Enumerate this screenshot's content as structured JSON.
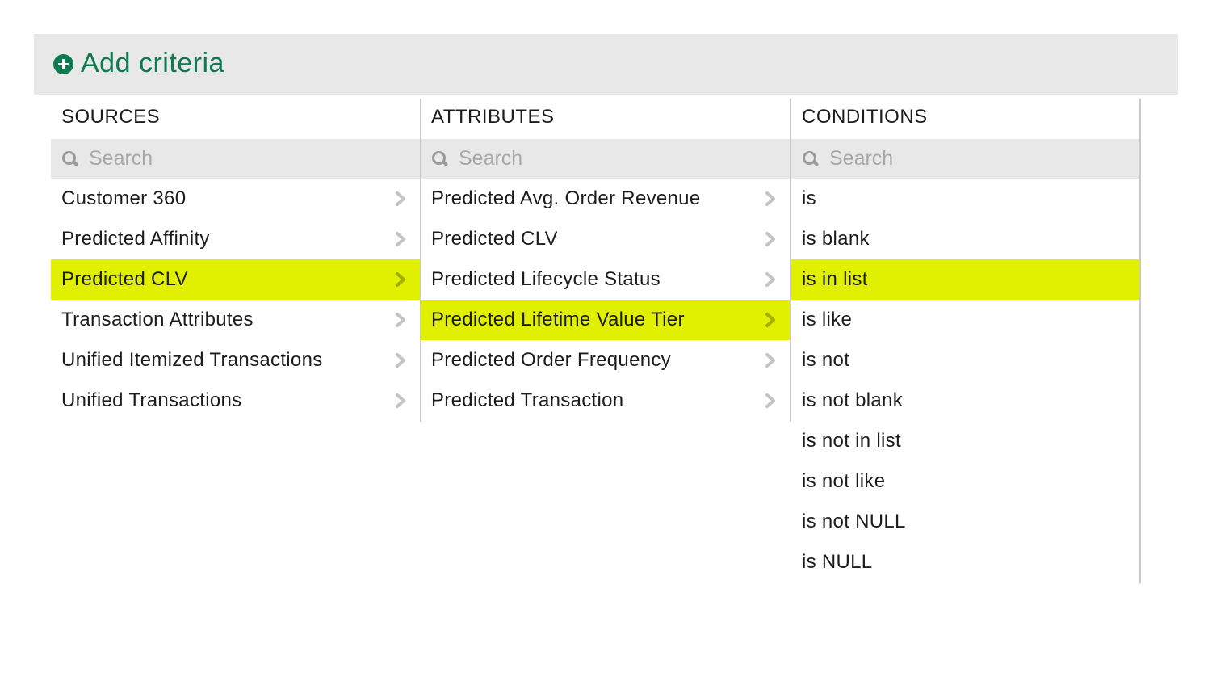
{
  "header": {
    "add_criteria_label": "Add criteria"
  },
  "sources": {
    "title": "SOURCES",
    "search_placeholder": "Search",
    "items": [
      {
        "label": "Customer 360",
        "selected": false
      },
      {
        "label": "Predicted Affinity",
        "selected": false
      },
      {
        "label": "Predicted CLV",
        "selected": true
      },
      {
        "label": "Transaction Attributes",
        "selected": false
      },
      {
        "label": "Unified Itemized Transactions",
        "selected": false
      },
      {
        "label": "Unified Transactions",
        "selected": false
      }
    ]
  },
  "attributes": {
    "title": "ATTRIBUTES",
    "search_placeholder": "Search",
    "items": [
      {
        "label": "Predicted Avg. Order Revenue",
        "selected": false
      },
      {
        "label": "Predicted CLV",
        "selected": false
      },
      {
        "label": "Predicted Lifecycle Status",
        "selected": false
      },
      {
        "label": "Predicted Lifetime Value Tier",
        "selected": true
      },
      {
        "label": "Predicted Order Frequency",
        "selected": false
      },
      {
        "label": "Predicted Transaction",
        "selected": false
      }
    ]
  },
  "conditions": {
    "title": "CONDITIONS",
    "search_placeholder": "Search",
    "items": [
      {
        "label": "is",
        "selected": false
      },
      {
        "label": "is blank",
        "selected": false
      },
      {
        "label": "is in list",
        "selected": true
      },
      {
        "label": "is like",
        "selected": false
      },
      {
        "label": "is not",
        "selected": false
      },
      {
        "label": "is not blank",
        "selected": false
      },
      {
        "label": "is not in list",
        "selected": false
      },
      {
        "label": "is not like",
        "selected": false
      },
      {
        "label": "is not NULL",
        "selected": false
      },
      {
        "label": "is NULL",
        "selected": false
      }
    ]
  },
  "colors": {
    "accent_green": "#0d7a4f",
    "selection_highlight": "#e0f000",
    "panel_gray": "#e8e8e8"
  },
  "icons": {
    "add": "plus-circle-icon",
    "search": "search-icon",
    "expand": "chevron-right-icon"
  }
}
